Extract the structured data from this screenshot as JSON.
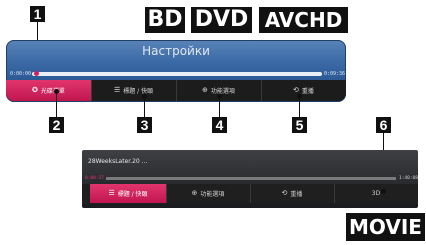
{
  "format_tags": {
    "bd": "BD",
    "dvd": "DVD",
    "avchd": "AVCHD",
    "movie": "MOVIE"
  },
  "callouts": [
    "1",
    "2",
    "3",
    "4",
    "5",
    "6"
  ],
  "disc_menu": {
    "title": "Настройки",
    "time_start": "0:00:00",
    "time_end": "0:09:36",
    "items": [
      {
        "label": "光碟選單",
        "icon": "disc-menu-icon",
        "glyph": "✪"
      },
      {
        "label": "標題 / 快頤",
        "icon": "title-list-icon",
        "glyph": "☰"
      },
      {
        "label": "功能選項",
        "icon": "option-icon",
        "glyph": "⊕"
      },
      {
        "label": "重播",
        "icon": "repeat-icon",
        "glyph": "⟲"
      }
    ]
  },
  "movie_menu": {
    "title": "28WeeksLater.20 ...",
    "time_start": "0:00:37",
    "time_end": "1:40:08",
    "items": [
      {
        "label": "標題 / 快頤",
        "icon": "title-list-icon",
        "glyph": "☰"
      },
      {
        "label": "功能選項",
        "icon": "option-icon",
        "glyph": "⊕"
      },
      {
        "label": "重播",
        "icon": "repeat-icon",
        "glyph": "⟲"
      },
      {
        "label": "3D",
        "icon": "3d-icon",
        "glyph": ""
      }
    ]
  },
  "colors": {
    "accent": "#d21f5c",
    "panel_blue": "#3b6aa6",
    "bar_dark": "#1c1c1c"
  }
}
